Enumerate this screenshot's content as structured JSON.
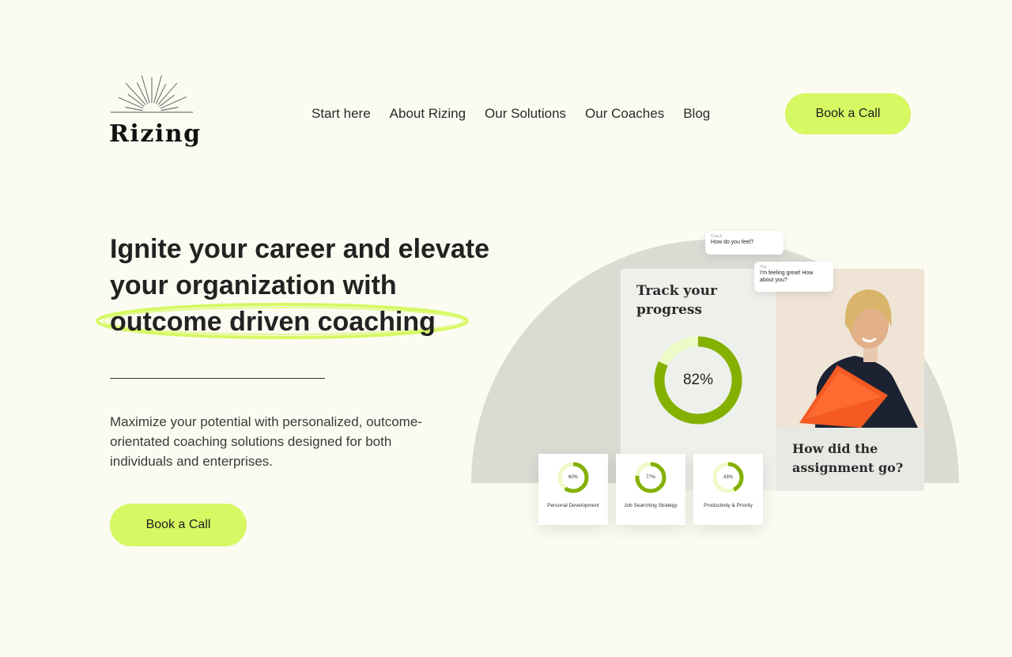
{
  "brand": {
    "name": "Rizing",
    "accent": "#d6f862",
    "ring_color": "#84b000",
    "ring_track": "#eefac8"
  },
  "nav": {
    "items": [
      {
        "label": "Start here"
      },
      {
        "label": "About Rizing"
      },
      {
        "label": "Our Solutions"
      },
      {
        "label": "Our Coaches"
      },
      {
        "label": "Blog"
      }
    ],
    "cta_label": "Book a Call"
  },
  "hero": {
    "headline_line1": "Ignite your career and elevate",
    "headline_line2": "your organization with",
    "headline_highlight": "outcome driven coaching",
    "subtext": "Maximize your potential with personalized, outcome-orientated coaching solutions designed for both individuals and enterprises.",
    "cta_label": "Book a Call"
  },
  "dashboard": {
    "track_title": "Track your progress",
    "overall_progress": {
      "percent": 82,
      "label": "82%"
    },
    "question": "How did the assignment go?",
    "chat": [
      {
        "sender": "Coach",
        "message": "How do you feel?"
      },
      {
        "sender": "You",
        "message": "I'm feeling great! How about you?"
      }
    ],
    "metrics": [
      {
        "percent": 60,
        "label_pct": "60%",
        "name": "Personal Development"
      },
      {
        "percent": 77,
        "label_pct": "77%",
        "name": "Job Searching Strategy"
      },
      {
        "percent": 43,
        "label_pct": "43%",
        "name": "Productivity & Priority"
      }
    ]
  }
}
